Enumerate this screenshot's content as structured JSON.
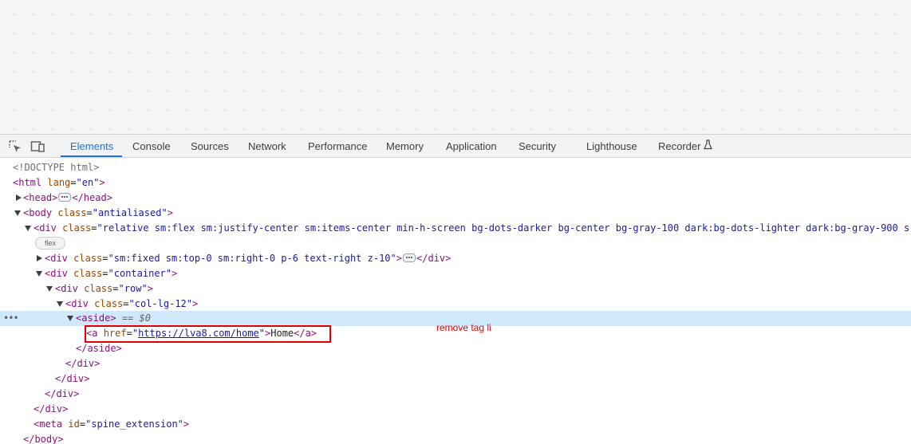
{
  "tabs": [
    {
      "label": "Elements",
      "active": true
    },
    {
      "label": "Console"
    },
    {
      "label": "Sources"
    },
    {
      "label": "Network"
    },
    {
      "label": "Performance"
    },
    {
      "label": "Memory"
    },
    {
      "label": "Application"
    },
    {
      "label": "Security"
    },
    {
      "label": "Lighthouse"
    },
    {
      "label": "Recorder",
      "icon": "flask-icon"
    }
  ],
  "toolbar_icons": [
    "inspect-element-icon",
    "device-toolbar-icon"
  ],
  "dom": {
    "doctype": "<!DOCTYPE html>",
    "html_open": {
      "tag": "html",
      "attr": "lang",
      "value": "en"
    },
    "head": {
      "open": "<head>",
      "close": "</head>"
    },
    "body_open": {
      "tag": "body",
      "attr": "class",
      "value": "antialiased"
    },
    "div_main": {
      "tag": "div",
      "attr": "class",
      "value": "relative sm:flex sm:justify-center sm:items-center min-h-screen bg-dots-darker bg-center bg-gray-100 dark:bg-dots-lighter dark:bg-gray-900 s"
    },
    "flex_badge": "flex",
    "div_fixed": {
      "tag": "div",
      "attr": "class",
      "value": "sm:fixed sm:top-0 sm:right-0 p-6 text-right z-10",
      "close": "</div>"
    },
    "div_container": {
      "tag": "div",
      "attr": "class",
      "value": "container"
    },
    "div_row": {
      "tag": "div",
      "attr": "class",
      "value": "row"
    },
    "div_col": {
      "tag": "div",
      "attr": "class",
      "value": "col-lg-12"
    },
    "aside_open": "<aside>",
    "aside_marker": "== $0",
    "anchor": {
      "attr": "href",
      "href": "https://lva8.com/home",
      "text": "Home"
    },
    "aside_close": "</aside>",
    "div_close": "</div>",
    "meta": {
      "tag": "meta",
      "attr": "id",
      "value": "spine_extension"
    },
    "body_close": "</body>"
  },
  "annotation": "remove tag li",
  "colors": {
    "highlight": "#e00000",
    "selected_row": "#cfe8fc",
    "active_tab": "#1a73e8"
  }
}
